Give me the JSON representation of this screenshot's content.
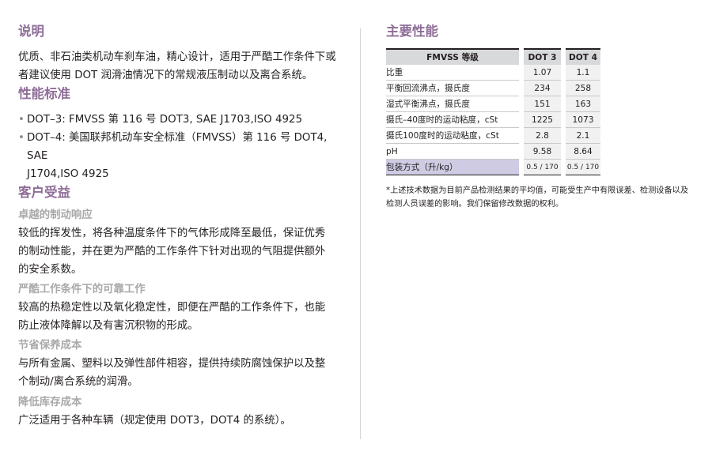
{
  "left": {
    "desc_heading": "说明",
    "desc_lines": [
      "优质、非石油类机动车刹车油，精心设计，适用于严酷工作条件下或",
      "者建议使用 DOT 润滑油情况下的常规液压制动以及离合系统。"
    ],
    "std_heading": "性能标准",
    "std_items": [
      [
        "DOT–3: FMVSS 第 116 号 DOT3, SAE J1703,ISO 4925"
      ],
      [
        "DOT–4: 美国联邦机动车安全标准（FMVSS）第 116 号 DOT4, SAE",
        "J1704,ISO 4925"
      ]
    ],
    "benefit_heading": "客户受益",
    "benefits": [
      {
        "title": "卓越的制动响应",
        "lines": [
          "较低的挥发性，将各种温度条件下的气体形成降至最低，保证优秀",
          "的制动性能，并在更为严酷的工作条件下针对出现的气阻提供额外",
          "的安全系数。"
        ]
      },
      {
        "title": "严酷工作条件下的可靠工作",
        "lines": [
          "较高的热稳定性以及氧化稳定性，即便在严酷的工作条件下，也能",
          "防止液体降解以及有害沉积物的形成。"
        ]
      },
      {
        "title": "节省保养成本",
        "lines": [
          "与所有金属、塑料以及弹性部件相容，提供持续防腐蚀保护以及整",
          "个制动/离合系统的润滑。"
        ]
      },
      {
        "title": "降低库存成本",
        "lines": [
          "广泛适用于各种车辆（规定使用 DOT3，DOT4 的系统）。"
        ]
      }
    ]
  },
  "right": {
    "heading": "主要性能",
    "table": {
      "header": [
        "FMVSS 等级",
        "DOT 3",
        "DOT 4"
      ],
      "rows": [
        [
          "比重",
          "1.07",
          "1.1"
        ],
        [
          "平衡回流沸点，摄氏度",
          "234",
          "258"
        ],
        [
          "湿式平衡沸点，摄氏度",
          "151",
          "163"
        ],
        [
          "摄氏–40度时的运动粘度，cSt",
          "1225",
          "1073"
        ],
        [
          "摄氏100度时的运动粘度，cSt",
          "2.8",
          "2.1"
        ],
        [
          "pH",
          "9.58",
          "8.64"
        ]
      ],
      "pack": [
        "包装方式（升/kg）",
        "0.5 / 170",
        "0.5 / 170"
      ]
    },
    "note_lines": [
      "*上述技术数据为目前产品检测结果的平均值，可能受生产中有限误差、检测设备以及",
      "检测人员误差的影响。我们保留修改数据的权利。"
    ]
  }
}
